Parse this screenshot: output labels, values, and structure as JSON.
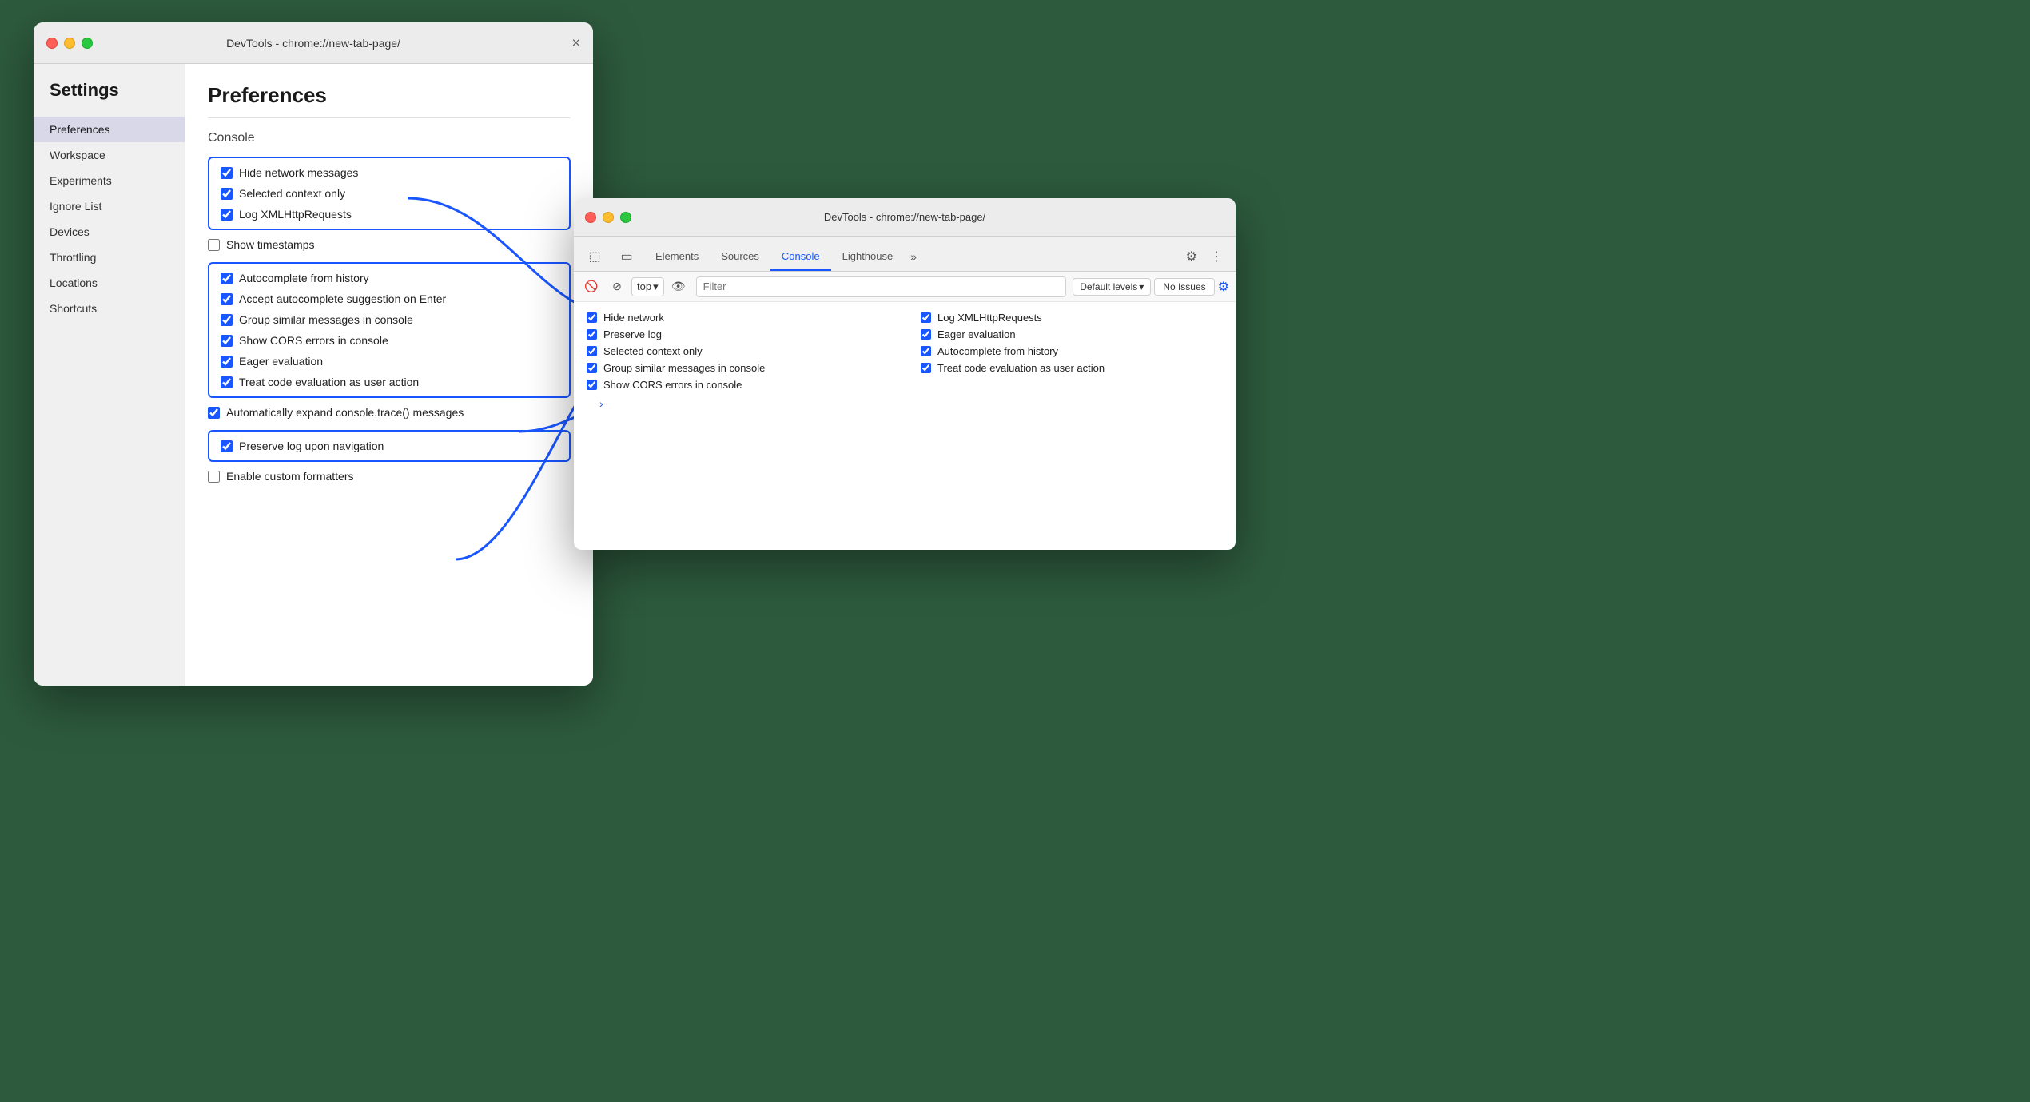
{
  "colors": {
    "background": "#2d5a3d",
    "accent_blue": "#1a56ff",
    "traffic_close": "#ff5f57",
    "traffic_minimize": "#febc2e",
    "traffic_maximize": "#28c840"
  },
  "left_window": {
    "titlebar_title": "DevTools - chrome://new-tab-page/",
    "close_symbol": "×",
    "settings_heading": "Settings",
    "sidebar_items": [
      {
        "label": "Preferences",
        "active": true
      },
      {
        "label": "Workspace",
        "active": false
      },
      {
        "label": "Experiments",
        "active": false
      },
      {
        "label": "Ignore List",
        "active": false
      },
      {
        "label": "Devices",
        "active": false
      },
      {
        "label": "Throttling",
        "active": false
      },
      {
        "label": "Locations",
        "active": false
      },
      {
        "label": "Shortcuts",
        "active": false
      }
    ],
    "preferences_title": "Preferences",
    "console_section": "Console",
    "checkboxes_group1": [
      {
        "label": "Hide network messages",
        "checked": true
      },
      {
        "label": "Selected context only",
        "checked": true
      },
      {
        "label": "Log XMLHttpRequests",
        "checked": true
      }
    ],
    "checkbox_show_timestamps": {
      "label": "Show timestamps",
      "checked": false
    },
    "checkboxes_group2": [
      {
        "label": "Autocomplete from history",
        "checked": true
      },
      {
        "label": "Accept autocomplete suggestion on Enter",
        "checked": true
      },
      {
        "label": "Group similar messages in console",
        "checked": true
      },
      {
        "label": "Show CORS errors in console",
        "checked": true
      },
      {
        "label": "Eager evaluation",
        "checked": true
      },
      {
        "label": "Treat code evaluation as user action",
        "checked": true
      }
    ],
    "checkbox_expand_trace": {
      "label": "Automatically expand console.trace() messages",
      "checked": true
    },
    "checkbox_preserve_log": {
      "label": "Preserve log upon navigation",
      "checked": true
    },
    "checkbox_custom_formatters": {
      "label": "Enable custom formatters",
      "checked": false
    }
  },
  "right_window": {
    "titlebar_title": "DevTools - chrome://new-tab-page/",
    "tabs": [
      {
        "label": "Elements",
        "active": false
      },
      {
        "label": "Sources",
        "active": false
      },
      {
        "label": "Console",
        "active": true
      },
      {
        "label": "Lighthouse",
        "active": false
      },
      {
        "label": "»",
        "active": false
      }
    ],
    "toolbar": {
      "top_label": "top",
      "filter_placeholder": "Filter",
      "levels_label": "Default levels",
      "no_issues_label": "No Issues"
    },
    "console_options_left": [
      {
        "label": "Hide network",
        "checked": true
      },
      {
        "label": "Preserve log",
        "checked": true
      },
      {
        "label": "Selected context only",
        "checked": true
      },
      {
        "label": "Group similar messages in console",
        "checked": true
      },
      {
        "label": "Show CORS errors in console",
        "checked": true
      }
    ],
    "console_options_right": [
      {
        "label": "Log XMLHttpRequests",
        "checked": true
      },
      {
        "label": "Eager evaluation",
        "checked": true
      },
      {
        "label": "Autocomplete from history",
        "checked": true
      },
      {
        "label": "Treat code evaluation as user action",
        "checked": true
      }
    ]
  }
}
